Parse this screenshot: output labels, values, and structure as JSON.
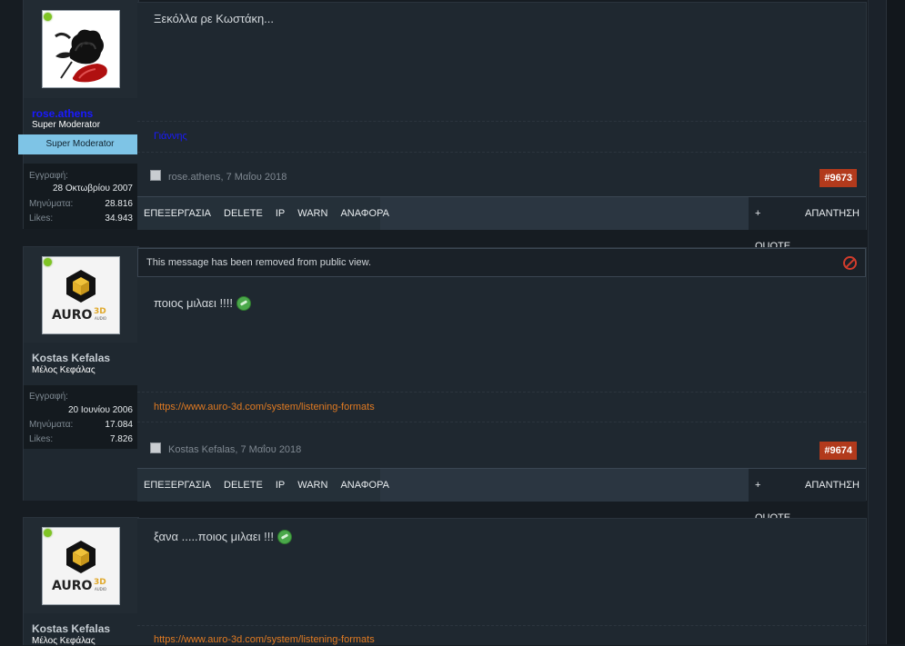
{
  "posts": [
    {
      "user": {
        "name": "rose.athens",
        "title": "Super Moderator",
        "rank": "Super Moderator",
        "avatar": "black-rose-avatar",
        "stats": [
          {
            "label": "Εγγραφή:",
            "value": "28 Οκτωβρίου 2007"
          },
          {
            "label": "Μηνύματα:",
            "value": "28.816"
          },
          {
            "label": "Likes:",
            "value": "34.943"
          }
        ]
      },
      "message": "Ξεκόλλα ρε Κωστάκη...",
      "signature": "Γιάννης",
      "meta": "rose.athens, 7 Μαΐου 2018",
      "number": "#9673"
    },
    {
      "user": {
        "name": "Kostas Kefalas",
        "title": "Μέλος Κεφάλας",
        "avatar": "auro-3d-audio-logo",
        "stats": [
          {
            "label": "Εγγραφή:",
            "value": "20 Ιουνίου 2006"
          },
          {
            "label": "Μηνύματα:",
            "value": "17.084"
          },
          {
            "label": "Likes:",
            "value": "7.826"
          }
        ]
      },
      "removed_notice": "This message has been removed from public view.",
      "message": "ποιος μιλαει !!!!",
      "signature": "https://www.auro-3d.com/system/listening-formats",
      "meta": "Kostas Kefalas, 7 Μαΐου 2018",
      "number": "#9674"
    },
    {
      "user": {
        "name": "Kostas Kefalas",
        "title": "Μέλος Κεφάλας",
        "avatar": "auro-3d-audio-logo"
      },
      "message": "ξανα .....ποιος μιλαει !!!",
      "signature": "https://www.auro-3d.com/system/listening-formats"
    }
  ],
  "toolbar": {
    "edit": "ΕΠΕΞΕΡΓΑΣΙΑ",
    "delete": "DELETE",
    "ip": "IP",
    "warn": "WARN",
    "report": "ΑΝΑΦΟΡΑ",
    "quote": "+ QUOTE",
    "reply": "ΑΠΑΝΤΗΣΗ"
  },
  "colors": {
    "background": "#161c22",
    "panel": "#1f2830",
    "accent_post_number": "#b23a1c",
    "link_orange": "#e07a22",
    "username_blue": "#1a1aff",
    "rank_ribbon": "#7ec4e6",
    "online": "#7fc424"
  }
}
